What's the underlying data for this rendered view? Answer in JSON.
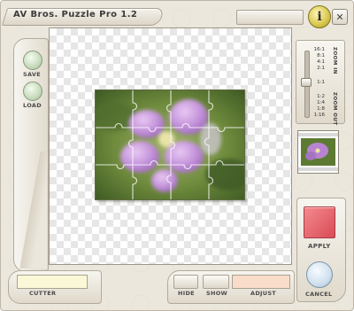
{
  "window": {
    "title": "AV Bros. Puzzle Pro 1.2"
  },
  "title_bar": {
    "info_label": "i",
    "close_label": "✕"
  },
  "left_panel": {
    "save_label": "SAVE",
    "load_label": "LOAD"
  },
  "zoom": {
    "zoom_in_label": "ZOOM IN",
    "zoom_out_label": "ZOOM OUT",
    "levels_in": [
      "16:1",
      "8:1",
      "4:1",
      "2:1"
    ],
    "level_current": "1:1",
    "levels_out": [
      "1:2",
      "1:4",
      "1:8",
      "1:16"
    ],
    "current_ratio": "1:1"
  },
  "right_panel": {
    "apply_label": "APPLY",
    "cancel_label": "CANCEL"
  },
  "bottom_bar": {
    "cutter_label": "CUTTER",
    "hide_label": "HIDE",
    "show_label": "SHOW",
    "adjust_label": "ADJUST"
  },
  "colors": {
    "frame": "#ece7dd",
    "apply": "#e0525c",
    "cutter_field": "#fbf8d8",
    "adjust_field": "#f9dcc9",
    "save_load": "#c7dbbb",
    "cancel": "#cfe0ee",
    "info": "#d8c64c"
  },
  "icons": {
    "info": "info-icon",
    "close": "close-icon"
  }
}
